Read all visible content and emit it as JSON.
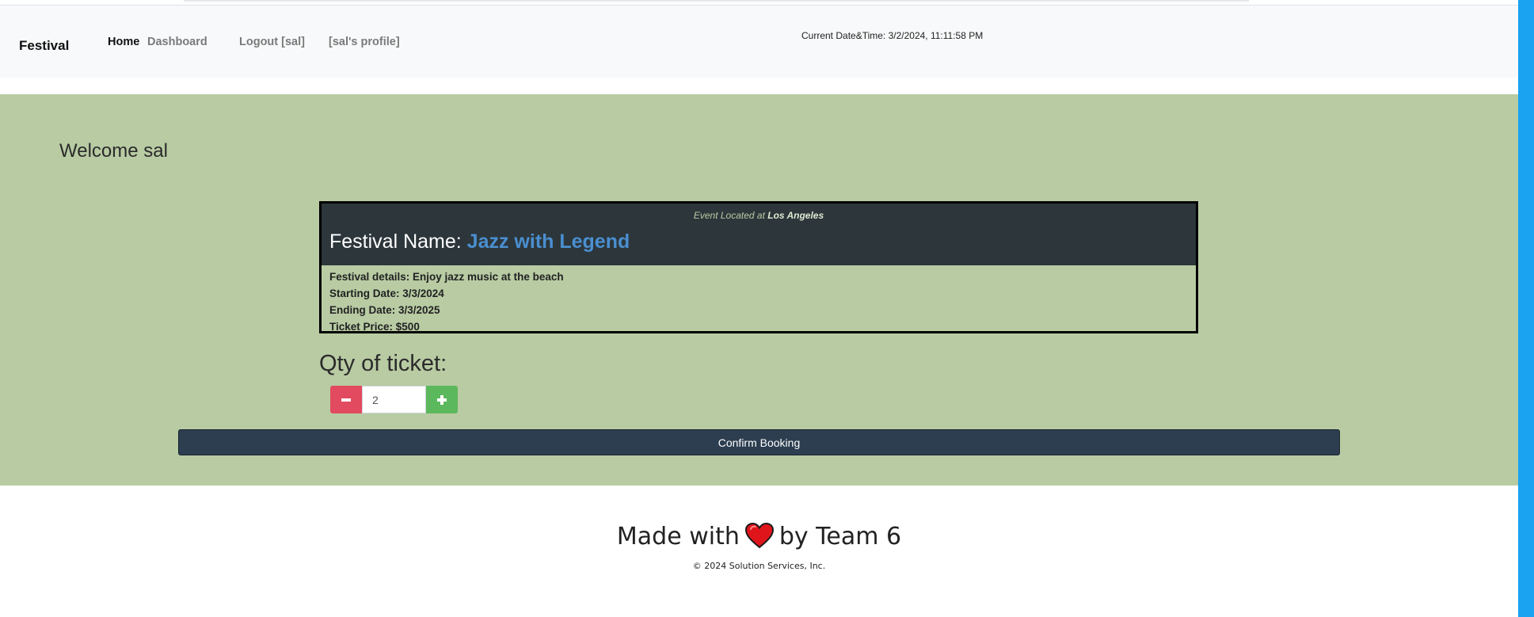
{
  "navbar": {
    "brand": "Festival",
    "links": {
      "home": "Home",
      "dashboard": "Dashboard",
      "logout": "Logout [sal]",
      "profile": "[sal's profile]"
    },
    "datetime": "Current Date&Time: 3/2/2024, 11:11:58 PM"
  },
  "main": {
    "welcome": "Welcome sal",
    "event": {
      "location_prefix": "Event Located at ",
      "location": "Los Angeles",
      "name_label": "Festival Name: ",
      "name": "Jazz with Legend",
      "details": "Festival details: Enjoy jazz music at the beach",
      "start": "Starting Date: 3/3/2024",
      "end": "Ending Date: 3/3/2025",
      "price": "Ticket Price: $500"
    },
    "qty_label": "Qty of ticket:",
    "qty_value": "2",
    "minus_icon": "minus-icon",
    "plus_icon": "plus-icon",
    "confirm_label": "Confirm Booking"
  },
  "footer": {
    "made_with": "Made with",
    "by_team": "by Team 6",
    "heart_icon": "heart-icon",
    "copyright": "© 2024 Solution Services, Inc."
  },
  "colors": {
    "main_bg": "#b8cba3",
    "card_head": "#2c363b",
    "festival_name": "#4a8fd0",
    "minus_btn": "#e24a5f",
    "plus_btn": "#5cb85c",
    "confirm_btn": "#2c3e50",
    "scrollbar": "#1aa3f0"
  }
}
